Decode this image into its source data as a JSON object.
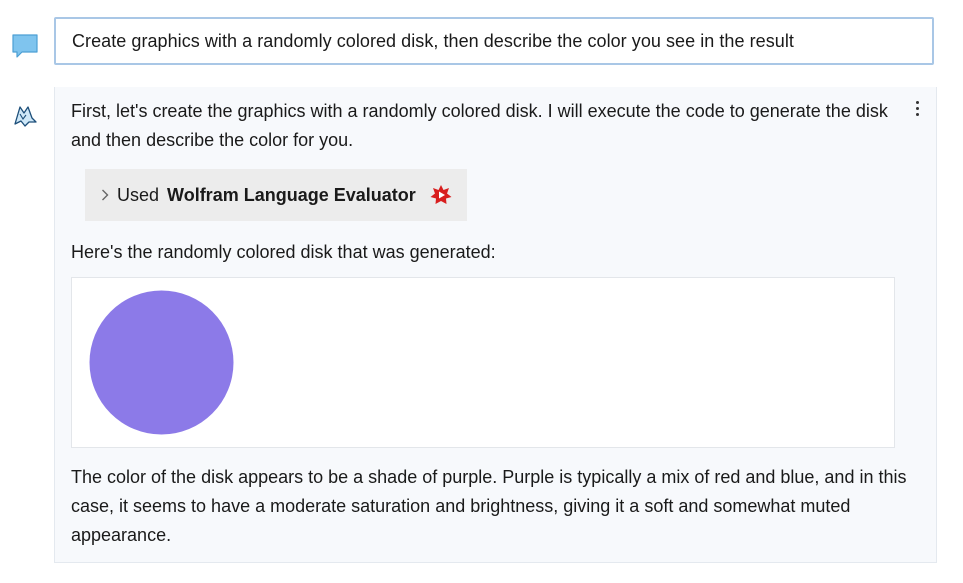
{
  "user_message": {
    "icon": "chat-bubble-icon",
    "text": "Create graphics with a randomly colored disk, then describe the color you see in the result"
  },
  "assistant": {
    "icon": "wolf-assistant-icon",
    "menu_icon": "kebab-menu-icon",
    "intro": "First, let's create the graphics with a randomly colored disk. I will execute the code to generate the disk and then describe the color for you.",
    "tool_call": {
      "used_label": "Used",
      "tool_name": "Wolfram Language Evaluator",
      "chevron_icon": "chevron-right-icon",
      "tool_icon": "wolfram-spikey-icon"
    },
    "result_intro": "Here's the randomly colored disk that was generated:",
    "graphic": {
      "shape": "disk",
      "color": "#8c7ae8"
    },
    "description": "The color of the disk appears to be a shade of purple. Purple is typically a mix of red and blue, and in this case, it seems to have a moderate saturation and brightness, giving it a soft and somewhat muted appearance."
  },
  "colors": {
    "user_border": "#a9c7e6",
    "user_icon": "#7fc4ee",
    "assistant_bg": "#f7f9fc",
    "tool_box_bg": "#ececec",
    "wolfram_red": "#d81e1e"
  }
}
